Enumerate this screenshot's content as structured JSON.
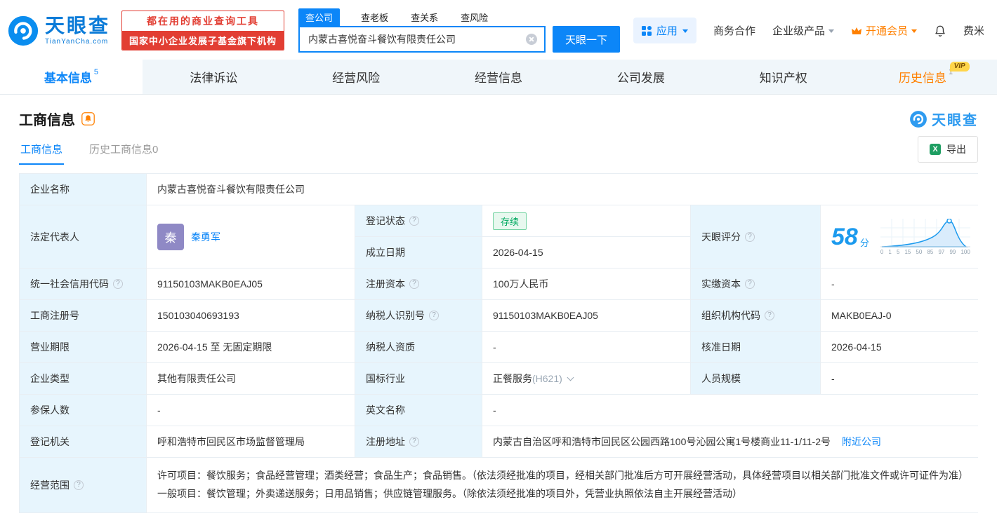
{
  "icons": {
    "help": "?"
  },
  "header": {
    "logo": {
      "cn": "天眼查",
      "en": "TianYanCha.com"
    },
    "slogan": {
      "line1": "都在用的商业查询工具",
      "line2": "国家中小企业发展子基金旗下机构"
    },
    "search": {
      "tabs": [
        "查公司",
        "查老板",
        "查关系",
        "查风险"
      ],
      "value": "内蒙古喜悦奋斗餐饮有限责任公司",
      "button": "天眼一下"
    },
    "menu": {
      "apps": "应用",
      "cooperation": "商务合作",
      "enterprise_products": "企业级产品",
      "vip": "开通会员",
      "user": "费米"
    }
  },
  "tabs": [
    {
      "label": "基本信息",
      "badge": "5"
    },
    {
      "label": "法律诉讼"
    },
    {
      "label": "经营风险"
    },
    {
      "label": "经营信息"
    },
    {
      "label": "公司发展"
    },
    {
      "label": "知识产权"
    },
    {
      "label": "历史信息",
      "badge": "1",
      "vip_tag": "VIP"
    }
  ],
  "section": {
    "title": "工商信息",
    "watermark": "天眼查",
    "sub_tabs": [
      "工商信息",
      "历史工商信息0"
    ],
    "export": "导出",
    "export_icon_letter": "X"
  },
  "fields": {
    "company_name": {
      "label": "企业名称",
      "value": "内蒙古喜悦奋斗餐饮有限责任公司"
    },
    "legal_rep": {
      "label": "法定代表人",
      "avatar": "秦",
      "value": "秦勇军"
    },
    "reg_status": {
      "label": "登记状态",
      "value": "存续"
    },
    "establish_date": {
      "label": "成立日期",
      "value": "2026-04-15"
    },
    "score": {
      "label": "天眼评分",
      "value": "58",
      "unit": "分",
      "axis": [
        "0",
        "1",
        "5",
        "15",
        "50",
        "85",
        "97",
        "99",
        "100"
      ]
    },
    "credit_code": {
      "label": "统一社会信用代码",
      "value": "91150103MAKB0EAJ05"
    },
    "reg_capital": {
      "label": "注册资本",
      "value": "100万人民币"
    },
    "paid_capital": {
      "label": "实缴资本",
      "value": "-"
    },
    "reg_number": {
      "label": "工商注册号",
      "value": "150103040693193"
    },
    "taxpayer_id": {
      "label": "纳税人识别号",
      "value": "91150103MAKB0EAJ05"
    },
    "org_code": {
      "label": "组织机构代码",
      "value": "MAKB0EAJ-0"
    },
    "business_term": {
      "label": "营业期限",
      "value": "2026-04-15 至 无固定期限"
    },
    "taxpayer_quality": {
      "label": "纳税人资质",
      "value": "-"
    },
    "approve_date": {
      "label": "核准日期",
      "value": "2026-04-15"
    },
    "company_type": {
      "label": "企业类型",
      "value": "其他有限责任公司"
    },
    "industry": {
      "label": "国标行业",
      "value": "正餐服务",
      "code": "(H621)"
    },
    "staff_size": {
      "label": "人员规模",
      "value": "-"
    },
    "insured_count": {
      "label": "参保人数",
      "value": "-"
    },
    "english_name": {
      "label": "英文名称",
      "value": "-"
    },
    "reg_authority": {
      "label": "登记机关",
      "value": "呼和浩特市回民区市场监督管理局"
    },
    "reg_address": {
      "label": "注册地址",
      "value": "内蒙古自治区呼和浩特市回民区公园西路100号沁园公寓1号楼商业11-1/11-2号",
      "link": "附近公司"
    },
    "business_scope": {
      "label": "经营范围",
      "value": "许可项目：餐饮服务；食品经营管理；酒类经营；食品生产；食品销售。（依法须经批准的项目，经相关部门批准后方可开展经营活动，具体经营项目以相关部门批准文件或许可证件为准）一般项目：餐饮管理；外卖递送服务；日用品销售；供应链管理服务。（除依法须经批准的项目外，凭营业执照依法自主开展经营活动）"
    }
  }
}
